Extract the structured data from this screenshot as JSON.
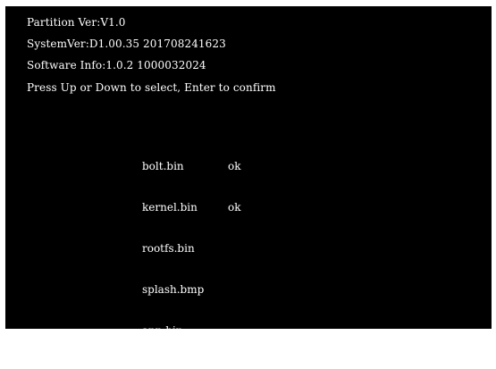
{
  "header": {
    "partition_ver": "Partition Ver:V1.0",
    "system_ver": "SystemVer:D1.00.35 201708241623",
    "software_info": "Software Info:1.0.2 1000032024",
    "prompt": "Press Up or Down to select, Enter to confirm"
  },
  "files": [
    {
      "name": "bolt.bin",
      "status": "ok"
    },
    {
      "name": "kernel.bin",
      "status": "ok"
    },
    {
      "name": "rootfs.bin",
      "status": ""
    },
    {
      "name": "splash.bmp",
      "status": ""
    },
    {
      "name": "app.bin",
      "status": ""
    }
  ],
  "colors": {
    "background": "#000000",
    "text": "#ffffff"
  }
}
